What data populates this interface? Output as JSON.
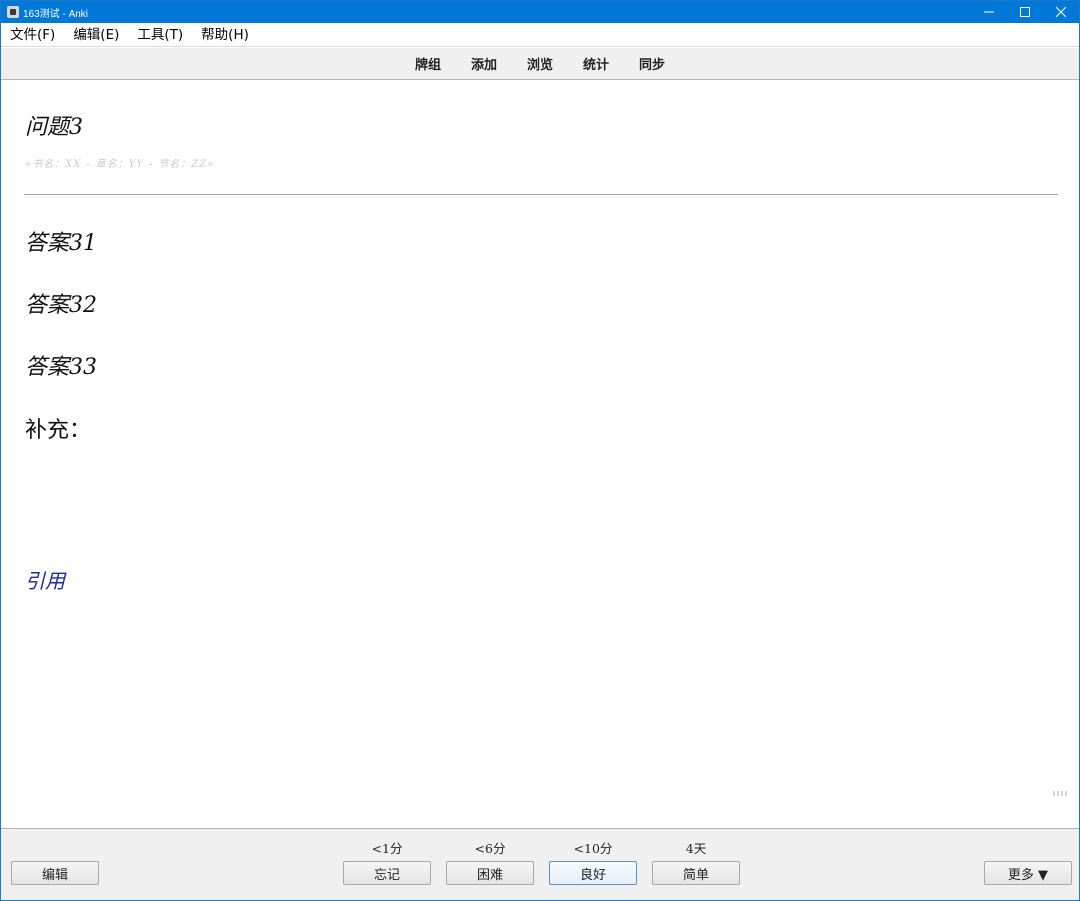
{
  "window": {
    "title": "163测试 - Anki",
    "controls": {
      "minimize_icon": "minimize-icon",
      "maximize_icon": "maximize-icon",
      "close_icon": "close-icon"
    }
  },
  "menubar": {
    "items": [
      "文件(F)",
      "编辑(E)",
      "工具(T)",
      "帮助(H)"
    ]
  },
  "toolbar": {
    "links": [
      "牌组",
      "添加",
      "浏览",
      "统计",
      "同步"
    ]
  },
  "card": {
    "question": "问题3",
    "source": "«书名：XX – 章名：YY – 节名：ZZ»",
    "answers": [
      "答案31",
      "答案32",
      "答案33"
    ],
    "supplement": "补充：",
    "reference": "引用"
  },
  "bottombar": {
    "edit_label": "编辑",
    "more_label": "更多 ▼",
    "answer_buttons": [
      {
        "label": "忘记",
        "interval": "<1分"
      },
      {
        "label": "困难",
        "interval": "<6分"
      },
      {
        "label": "良好",
        "interval": "<10分"
      },
      {
        "label": "简单",
        "interval": "4天"
      }
    ]
  },
  "colors": {
    "titlebar": "#0078d7",
    "reference_text": "#1a2a9c",
    "source_text": "#c8c8c8"
  }
}
